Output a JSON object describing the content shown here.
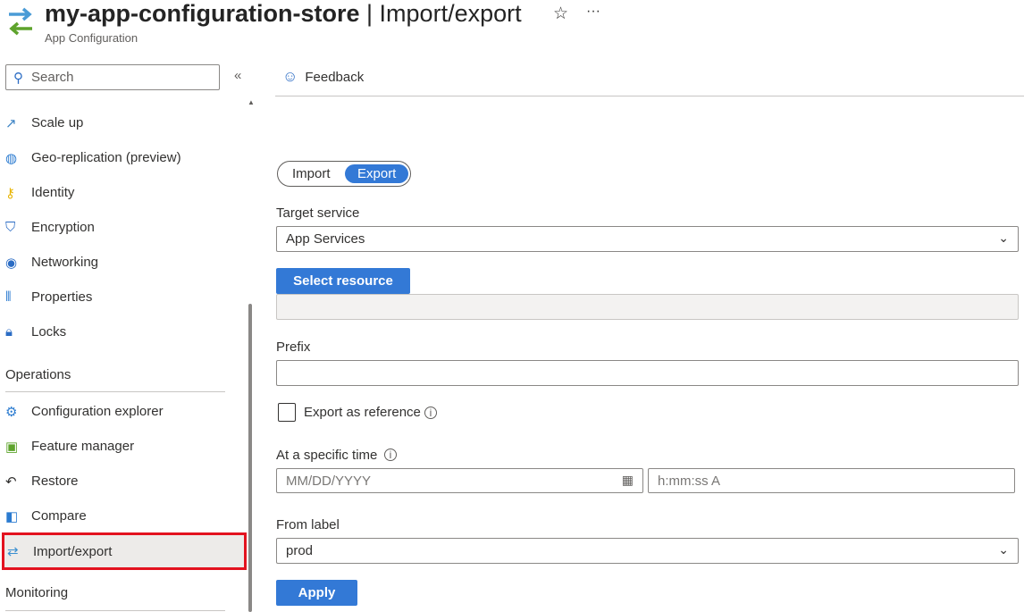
{
  "header": {
    "title": "my-app-configuration-store",
    "section": "Import/export",
    "subtitle": "App Configuration",
    "star_icon": "star-icon",
    "more_icon": "ellipsis-icon"
  },
  "sidebar": {
    "search_placeholder": "Search",
    "collapse_icon": "double-chevron-left-icon",
    "items": [
      {
        "label": "Scale up",
        "icon": "scale-up-icon"
      },
      {
        "label": "Geo-replication (preview)",
        "icon": "globe-icon"
      },
      {
        "label": "Identity",
        "icon": "key-icon"
      },
      {
        "label": "Encryption",
        "icon": "shield-icon"
      },
      {
        "label": "Networking",
        "icon": "network-icon"
      },
      {
        "label": "Properties",
        "icon": "properties-icon"
      },
      {
        "label": "Locks",
        "icon": "lock-icon"
      }
    ],
    "operations_heading": "Operations",
    "operations": [
      {
        "label": "Configuration explorer",
        "icon": "config-explorer-icon"
      },
      {
        "label": "Feature manager",
        "icon": "feature-manager-icon"
      },
      {
        "label": "Restore",
        "icon": "restore-icon"
      },
      {
        "label": "Compare",
        "icon": "compare-icon"
      },
      {
        "label": "Import/export",
        "icon": "import-export-icon",
        "selected": true
      }
    ],
    "monitoring_heading": "Monitoring"
  },
  "toolbar": {
    "feedback_label": "Feedback"
  },
  "form": {
    "mode_options": [
      "Import",
      "Export"
    ],
    "mode_selected": "Export",
    "target_service_label": "Target service",
    "target_service_value": "App Services",
    "select_resource_label": "Select resource",
    "resource_value": "",
    "prefix_label": "Prefix",
    "prefix_value": "",
    "export_reference_label": "Export as reference",
    "export_reference_checked": false,
    "specific_time_label": "At a specific time",
    "date_placeholder": "MM/DD/YYYY",
    "time_placeholder": "h:mm:ss A",
    "from_label_label": "From label",
    "from_label_value": "prod",
    "apply_label": "Apply"
  },
  "colors": {
    "accent": "#3379d6",
    "selected_outline": "#e3121f"
  }
}
